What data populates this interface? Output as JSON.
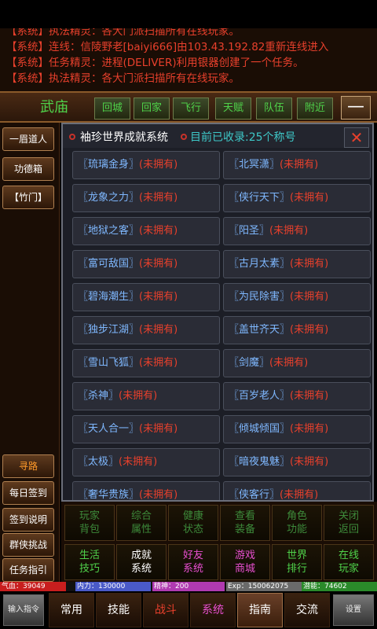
{
  "messages": [
    "【系统】执法精灵：各大门派扫描所有在线玩家。",
    "【系统】连线：信陵野老[baiyi666]由103.43.192.82重新连线进入",
    "【系统】任务精灵：进程(DELIVER)利用银器创建了一个任务。",
    "【系统】执法精灵：各大门派扫描所有在线玩家。"
  ],
  "location": {
    "name": "武庙",
    "buttons": [
      "回城",
      "回家",
      "飞行",
      "天赋",
      "队伍",
      "附近"
    ],
    "collapse": "—"
  },
  "left_column": {
    "top": [
      "一眉道人",
      "功德箱",
      "【竹门】"
    ],
    "bottom": [
      "寻路",
      "每日签到",
      "签到说明",
      "群侠挑战",
      "任务指引"
    ]
  },
  "dialog": {
    "title": "袖珍世界成就系统",
    "count": "目前已收录:25个称号",
    "close": "✕",
    "achievements": [
      {
        "name": "〖琉璃金身〗",
        "status": "(未拥有)"
      },
      {
        "name": "〖北冥潇〗",
        "status": "(未拥有)"
      },
      {
        "name": "〖龙象之力〗",
        "status": "(未拥有)"
      },
      {
        "name": "〖侠行天下〗",
        "status": "(未拥有)"
      },
      {
        "name": "〖地狱之客〗",
        "status": "(未拥有)"
      },
      {
        "name": "〖阳圣〗",
        "status": "(未拥有)"
      },
      {
        "name": "〖富可敌国〗",
        "status": "(未拥有)"
      },
      {
        "name": "〖古月太素〗",
        "status": "(未拥有)"
      },
      {
        "name": "〖碧海潮生〗",
        "status": "(未拥有)"
      },
      {
        "name": "〖为民除害〗",
        "status": "(未拥有)"
      },
      {
        "name": "〖独步江湖〗",
        "status": "(未拥有)"
      },
      {
        "name": "〖盖世齐天〗",
        "status": "(未拥有)"
      },
      {
        "name": "〖雪山飞狐〗",
        "status": "(未拥有)"
      },
      {
        "name": "〖剑魔〗",
        "status": "(未拥有)"
      },
      {
        "name": "〖杀神〗",
        "status": "(未拥有)"
      },
      {
        "name": "〖百岁老人〗",
        "status": "(未拥有)"
      },
      {
        "name": "〖天人合一〗",
        "status": "(未拥有)"
      },
      {
        "name": "〖倾城倾国〗",
        "status": "(未拥有)"
      },
      {
        "name": "〖太极〗",
        "status": "(未拥有)"
      },
      {
        "name": "〖暗夜鬼魅〗",
        "status": "(未拥有)"
      },
      {
        "name": "〖奢华贵族〗",
        "status": "(未拥有)"
      },
      {
        "name": "〖侠客行〗",
        "status": "(未拥有)"
      }
    ]
  },
  "functions": [
    {
      "line1": "玩家",
      "line2": "背包",
      "color": "c1"
    },
    {
      "line1": "综合",
      "line2": "属性",
      "color": "c1"
    },
    {
      "line1": "健康",
      "line2": "状态",
      "color": "c1"
    },
    {
      "line1": "查看",
      "line2": "装备",
      "color": "c1"
    },
    {
      "line1": "角色",
      "line2": "功能",
      "color": "c1"
    },
    {
      "line1": "关闭",
      "line2": "返回",
      "color": "c1"
    },
    {
      "line1": "生活",
      "line2": "技巧",
      "color": "c2"
    },
    {
      "line1": "成就",
      "line2": "系统",
      "color": "c3"
    },
    {
      "line1": "好友",
      "line2": "系统",
      "color": "c4"
    },
    {
      "line1": "游戏",
      "line2": "商城",
      "color": "c4"
    },
    {
      "line1": "世界",
      "line2": "排行",
      "color": "c2"
    },
    {
      "line1": "在线",
      "line2": "玩家",
      "color": "c2"
    }
  ],
  "stats": {
    "hp": "气血：39049",
    "force": "内力：130000",
    "spirit": "精神：200",
    "exp": "Exp：150062075",
    "potential": "潜能：74602",
    "colors": {
      "hp": "#c81e1e",
      "force": "#4a5ac8",
      "spirit": "#b03ab0",
      "exp": "#6a6a6a",
      "potential": "#2a8a2a"
    }
  },
  "tabs": {
    "input": "输入指令",
    "items": [
      {
        "label": "常用",
        "style": "white"
      },
      {
        "label": "技能",
        "style": "white"
      },
      {
        "label": "战斗",
        "style": "red"
      },
      {
        "label": "系统",
        "style": "pink"
      },
      {
        "label": "指南",
        "style": "sel"
      },
      {
        "label": "交流",
        "style": "white"
      }
    ],
    "settings": "设置"
  }
}
